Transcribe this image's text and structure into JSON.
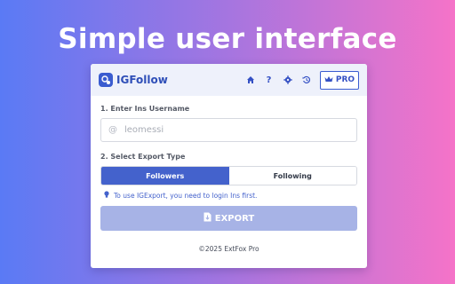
{
  "headline": "Simple user interface",
  "app": {
    "name": "IGFollow",
    "pro_label": "PRO"
  },
  "step1": {
    "label": "1. Enter Ins Username",
    "at_symbol": "@",
    "placeholder": "leomessi"
  },
  "step2": {
    "label": "2. Select Export Type",
    "options": [
      "Followers",
      "Following"
    ],
    "selected": "Followers"
  },
  "tip": "To use IGExport, you need to login Ins first.",
  "export_label": "EXPORT",
  "footer": "©2025 ExtFox Pro",
  "colors": {
    "accent": "#4462cc",
    "export_disabled": "#a7b3e6",
    "topbar_bg": "#eef1fb"
  },
  "icons": [
    "home-icon",
    "help-icon",
    "settings-icon",
    "history-icon",
    "crown-icon",
    "bulb-icon",
    "file-export-icon"
  ]
}
